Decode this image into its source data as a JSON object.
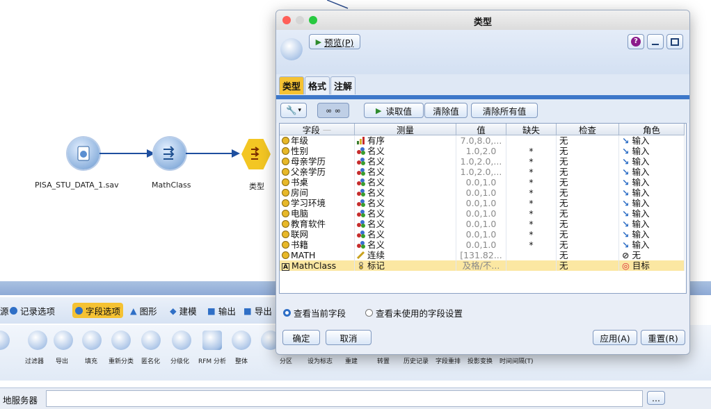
{
  "canvas": {
    "nodes": [
      {
        "label": "PISA_STU_DATA_1.sav"
      },
      {
        "label": "MathClass"
      },
      {
        "label": "类型"
      }
    ]
  },
  "palette": {
    "tabs": [
      {
        "label": "源"
      },
      {
        "label": "记录选项"
      },
      {
        "label": "字段选项"
      },
      {
        "label": "图形"
      },
      {
        "label": "建模"
      },
      {
        "label": "输出"
      },
      {
        "label": "导出"
      }
    ],
    "active_tab": "字段选项",
    "items": [
      "过滤器",
      "导出",
      "填充",
      "重新分类",
      "匿名化",
      "分级化",
      "RFM 分析",
      "整体",
      "分区",
      "设为标志",
      "重建",
      "转置",
      "历史记录",
      "字段重排",
      "投影变换",
      "时间间隔(T)"
    ]
  },
  "statusbar": {
    "server_label": "地服务器",
    "more_button": "..."
  },
  "dialog": {
    "title": "类型",
    "preview_button": "预览(P)",
    "help_icon": "?",
    "tabs": [
      "类型",
      "格式",
      "注解"
    ],
    "toolbar": {
      "read_values": "读取值",
      "clear_values": "清除值",
      "clear_all_values": "清除所有值"
    },
    "columns": [
      "字段",
      "测量",
      "值",
      "缺失",
      "检查",
      "角色"
    ],
    "rows": [
      {
        "field": "年级",
        "measure": "有序",
        "value": "7.0,8.0,...",
        "missing": "",
        "check": "无",
        "role": "输入",
        "mtype": "ordinal",
        "rtype": "input"
      },
      {
        "field": "性别",
        "measure": "名义",
        "value": "1.0,2.0",
        "missing": "*",
        "check": "无",
        "role": "输入",
        "mtype": "nominal",
        "rtype": "input"
      },
      {
        "field": "母亲学历",
        "measure": "名义",
        "value": "1.0,2.0,...",
        "missing": "*",
        "check": "无",
        "role": "输入",
        "mtype": "nominal",
        "rtype": "input"
      },
      {
        "field": "父亲学历",
        "measure": "名义",
        "value": "1.0,2.0,...",
        "missing": "*",
        "check": "无",
        "role": "输入",
        "mtype": "nominal",
        "rtype": "input"
      },
      {
        "field": "书桌",
        "measure": "名义",
        "value": "0.0,1.0",
        "missing": "*",
        "check": "无",
        "role": "输入",
        "mtype": "nominal",
        "rtype": "input"
      },
      {
        "field": "房间",
        "measure": "名义",
        "value": "0.0,1.0",
        "missing": "*",
        "check": "无",
        "role": "输入",
        "mtype": "nominal",
        "rtype": "input"
      },
      {
        "field": "学习环境",
        "measure": "名义",
        "value": "0.0,1.0",
        "missing": "*",
        "check": "无",
        "role": "输入",
        "mtype": "nominal",
        "rtype": "input"
      },
      {
        "field": "电脑",
        "measure": "名义",
        "value": "0.0,1.0",
        "missing": "*",
        "check": "无",
        "role": "输入",
        "mtype": "nominal",
        "rtype": "input"
      },
      {
        "field": "教育软件",
        "measure": "名义",
        "value": "0.0,1.0",
        "missing": "*",
        "check": "无",
        "role": "输入",
        "mtype": "nominal",
        "rtype": "input"
      },
      {
        "field": "联网",
        "measure": "名义",
        "value": "0.0,1.0",
        "missing": "*",
        "check": "无",
        "role": "输入",
        "mtype": "nominal",
        "rtype": "input"
      },
      {
        "field": "书籍",
        "measure": "名义",
        "value": "0.0,1.0",
        "missing": "*",
        "check": "无",
        "role": "输入",
        "mtype": "nominal",
        "rtype": "input"
      },
      {
        "field": "MATH",
        "measure": "连续",
        "value": "[131.82...",
        "missing": "",
        "check": "无",
        "role": "无",
        "mtype": "continuous",
        "rtype": "none"
      },
      {
        "field": "MathClass",
        "measure": "标记",
        "value": "及格/不...",
        "missing": "",
        "check": "无",
        "role": "目标",
        "mtype": "flag",
        "rtype": "target"
      }
    ],
    "radio": {
      "current": "查看当前字段",
      "unused": "查看未使用的字段设置",
      "selected": "current"
    },
    "buttons": {
      "ok": "确定",
      "cancel": "取消",
      "apply": "应用(A)",
      "reset": "重置(R)"
    }
  },
  "colors": {
    "accent_yellow": "#f5c233",
    "accent_blue": "#3d77c9",
    "role_input": "#2f6fc6",
    "role_target": "#d9252f"
  }
}
